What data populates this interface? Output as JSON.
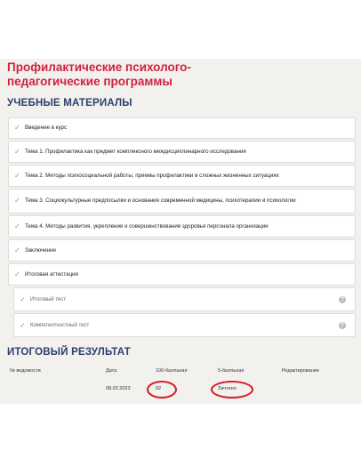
{
  "course": {
    "title": "Профилактические психолого-педагогические программы"
  },
  "materials": {
    "heading": "УЧЕБНЫЕ МАТЕРИАЛЫ",
    "items": [
      {
        "label": "Введение в курс"
      },
      {
        "label": "Тема 1. Профилактика как предмет комплексного междисциплинарного исследования"
      },
      {
        "label": "Тема 2. Методы психосоциальной работы, приемы профилактики в сложных жизненных ситуациях"
      },
      {
        "label": "Тема 3. Социокультурные предпосылки и основания современной медицины, психотерапии и психологии"
      },
      {
        "label": "Тема 4. Методы развития, укрепления и совершенствования здоровья персонала организации"
      },
      {
        "label": "Заключение"
      },
      {
        "label": "Итоговая аттестация"
      }
    ],
    "sub_items": [
      {
        "label": "Итоговый тест",
        "help": "?"
      },
      {
        "label": "Компетентностный тест",
        "help": "?"
      }
    ]
  },
  "results": {
    "heading": "ИТОГОВЫЙ РЕЗУЛЬТАТ",
    "columns": [
      "№ ведомости",
      "Дата",
      "100-балльная",
      "5-балльная",
      "Редактирование"
    ],
    "row": {
      "number": "",
      "date": "08.02.2023",
      "score100": "92",
      "score5": "Зачтено",
      "edit": ""
    }
  },
  "colors": {
    "title": "#d0233d",
    "heading": "#2c3e6b",
    "check": "#6fb33b",
    "annotation_ring": "#d21f2a",
    "panel_bg": "#f2f1ee"
  },
  "icons": {
    "check": "✓",
    "help": "question-circle-icon"
  }
}
